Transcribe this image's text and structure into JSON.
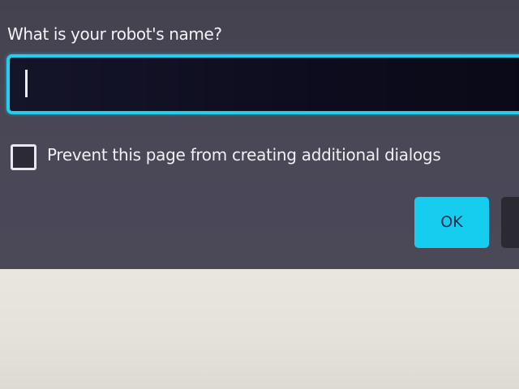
{
  "dialog": {
    "prompt_label": "What is your robot's name?",
    "input": {
      "value": "",
      "placeholder": ""
    },
    "prevent_dialogs": {
      "label": "Prevent this page from creating additional dialogs",
      "checked": false
    },
    "buttons": {
      "ok_label": "OK"
    }
  },
  "colors": {
    "dialog_background": "#4a4757",
    "accent": "#14cdef",
    "input_background": "#0d0c1e",
    "page_background": "#e6e3dd"
  }
}
